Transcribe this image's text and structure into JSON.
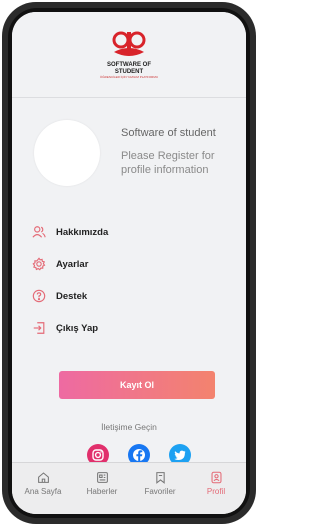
{
  "app": {
    "logo_line1": "SOFTWARE OF",
    "logo_line2": "STUDENT",
    "logo_sub": "ÖĞRENCİLER İÇİN YAZILIM PLATFORMU"
  },
  "profile": {
    "name": "Software of student",
    "message": "Please Register for profile information"
  },
  "menu": [
    {
      "label": "Hakkımızda",
      "icon": "users-icon"
    },
    {
      "label": "Ayarlar",
      "icon": "gear-icon"
    },
    {
      "label": "Destek",
      "icon": "help-icon"
    },
    {
      "label": "Çıkış Yap",
      "icon": "logout-icon"
    }
  ],
  "register_button": {
    "label": "Kayıt Ol"
  },
  "contact": {
    "label": "İletişime Geçin",
    "social": [
      {
        "name": "instagram-icon",
        "color": "#e1306c"
      },
      {
        "name": "facebook-icon",
        "color": "#1877f2"
      },
      {
        "name": "twitter-icon",
        "color": "#1da1f2"
      }
    ]
  },
  "bottom_nav": [
    {
      "label": "Ana Sayfa",
      "icon": "home-icon",
      "active": false
    },
    {
      "label": "Haberler",
      "icon": "news-icon",
      "active": false
    },
    {
      "label": "Favoriler",
      "icon": "bookmark-icon",
      "active": false
    },
    {
      "label": "Profil",
      "icon": "profile-icon",
      "active": true
    }
  ],
  "colors": {
    "accent": "#e46a76",
    "button_gradient_start": "#ee6aa2",
    "button_gradient_end": "#f3836e"
  }
}
